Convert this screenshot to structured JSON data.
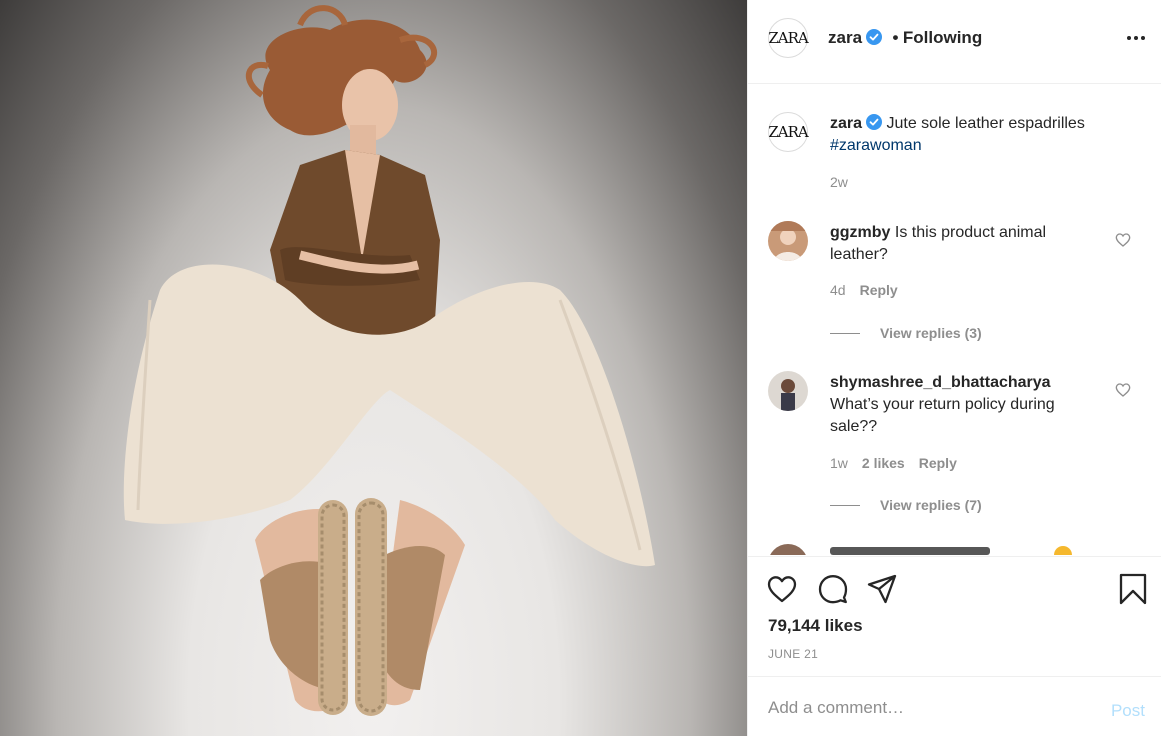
{
  "header": {
    "logo_text": "ZARA",
    "username": "zara",
    "separator": "•",
    "follow_status": "Following"
  },
  "caption": {
    "username": "zara",
    "text": "Jute sole leather espadrilles",
    "hashtag": "#zarawoman",
    "time": "2w"
  },
  "comments": [
    {
      "username": "ggzmby",
      "text": "Is this product animal leather?",
      "time": "4d",
      "reply_label": "Reply",
      "view_replies": "View replies (3)"
    },
    {
      "username": "shymashree_d_bhattacharya",
      "text": "What’s your return policy during sale??",
      "time": "1w",
      "likes": "2 likes",
      "reply_label": "Reply",
      "view_replies": "View replies (7)"
    }
  ],
  "post": {
    "likes": "79,144 likes",
    "date": "JUNE 21"
  },
  "add_comment": {
    "placeholder": "Add a comment…",
    "post_label": "Post"
  },
  "colors": {
    "verified_badge": "#3897f0",
    "link": "#00376b",
    "secondary_text": "#8e8e8e",
    "post_disabled": "#b2dffc"
  },
  "icons": [
    "heart-icon",
    "comment-icon",
    "share-icon",
    "bookmark-icon",
    "more-options-icon",
    "verified-badge-icon"
  ]
}
